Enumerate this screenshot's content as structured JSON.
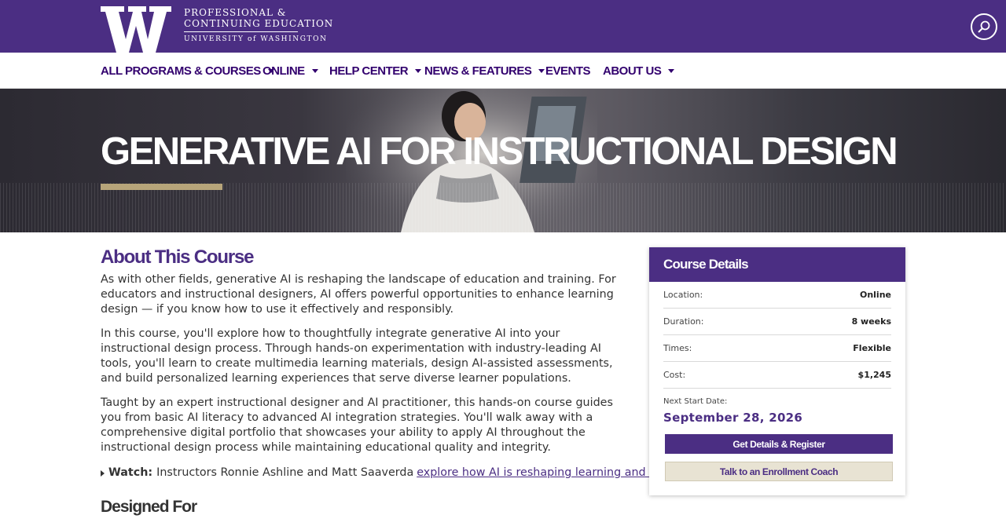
{
  "header": {
    "logo_line1": "PROFESSIONAL &",
    "logo_line2": "CONTINUING EDUCATION",
    "logo_line3": "UNIVERSITY of WASHINGTON",
    "search_icon": "search-icon"
  },
  "nav": {
    "items": [
      {
        "label": "ALL PROGRAMS & COURSES",
        "dropdown": true
      },
      {
        "label": "ONLINE",
        "dropdown": true
      },
      {
        "label": "HELP CENTER",
        "dropdown": true
      },
      {
        "label": "NEWS & FEATURES",
        "dropdown": true
      },
      {
        "label": "EVENTS",
        "dropdown": false
      },
      {
        "label": "ABOUT US",
        "dropdown": true
      }
    ]
  },
  "hero": {
    "title": "GENERATIVE AI FOR INSTRUCTIONAL DESIGN"
  },
  "about": {
    "heading": "About This Course",
    "paragraphs": [
      "As with other fields, generative AI is reshaping the landscape of education and training. For educators and instructional designers, AI offers powerful opportunities to enhance learning design — if you know how to use it effectively and responsibly.",
      "In this course, you'll explore how to thoughtfully integrate generative AI into your instructional design process. Through hands-on experimentation with industry-leading AI tools, you'll learn to create multimedia learning materials, design AI-assisted assessments, and build personalized learning experiences that serve diverse learner populations.",
      "Taught by an expert instructional designer and AI practitioner, this hands-on course guides you from basic AI literacy to advanced AI integration strategies. You'll walk away with a comprehensive digital portfolio that showcases your ability to apply AI throughout the instructional design process while maintaining educational quality and integrity."
    ],
    "watch_label": "Watch:",
    "watch_text": "Instructors Ronnie Ashline and Matt Saaverda",
    "watch_link": "explore how AI is reshaping learning and development",
    "watch_end": "."
  },
  "designed_for": {
    "heading": "Designed For"
  },
  "course_details": {
    "heading": "Course Details",
    "rows": [
      {
        "label": "Location:",
        "value": "Online"
      },
      {
        "label": "Duration:",
        "value": "8 weeks"
      },
      {
        "label": "Times:",
        "value": "Flexible"
      },
      {
        "label": "Cost:",
        "value": "$1,245"
      }
    ],
    "next_start_label": "Next Start Date:",
    "next_start_value": "September 28, 2026",
    "register_button": "Get Details & Register",
    "coach_button": "Talk to an Enrollment Coach"
  },
  "colors": {
    "brand_purple": "#4b2e83",
    "gold": "#b7a57a"
  }
}
